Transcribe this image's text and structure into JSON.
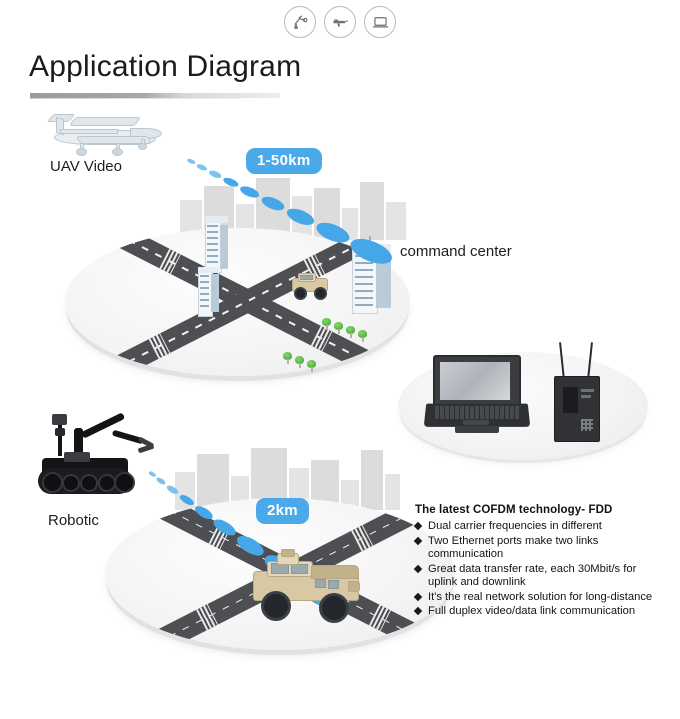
{
  "topbar": {
    "icons": [
      {
        "name": "robotic-arm-icon",
        "label": "Robotic Arm"
      },
      {
        "name": "weapon-icon",
        "label": "Weapon"
      },
      {
        "name": "laptop-icon",
        "label": "Laptop"
      }
    ]
  },
  "header": {
    "title": "Application Diagram"
  },
  "scenes": {
    "uav_label": "UAV Video",
    "command_center_label": "command center",
    "robotic_label": "Robotic",
    "distance_top": "1-50km",
    "distance_bottom": "2km"
  },
  "features": {
    "heading": "The latest COFDM technology- FDD",
    "items": [
      "Dual carrier frequencies in different",
      "Two Ethernet ports make two links communication",
      "Great data transfer rate, each 30Mbit/s for uplink and downlink",
      "It's the real network solution for long-distance",
      "Full duplex video/data link communication"
    ]
  },
  "colors": {
    "signal_blue": "#45a7e8",
    "badge_blue": "#49a9e9",
    "road_gray": "#4e4f53",
    "platform_gray": "#f0f0f0",
    "text_dark": "#1b1b1b"
  }
}
